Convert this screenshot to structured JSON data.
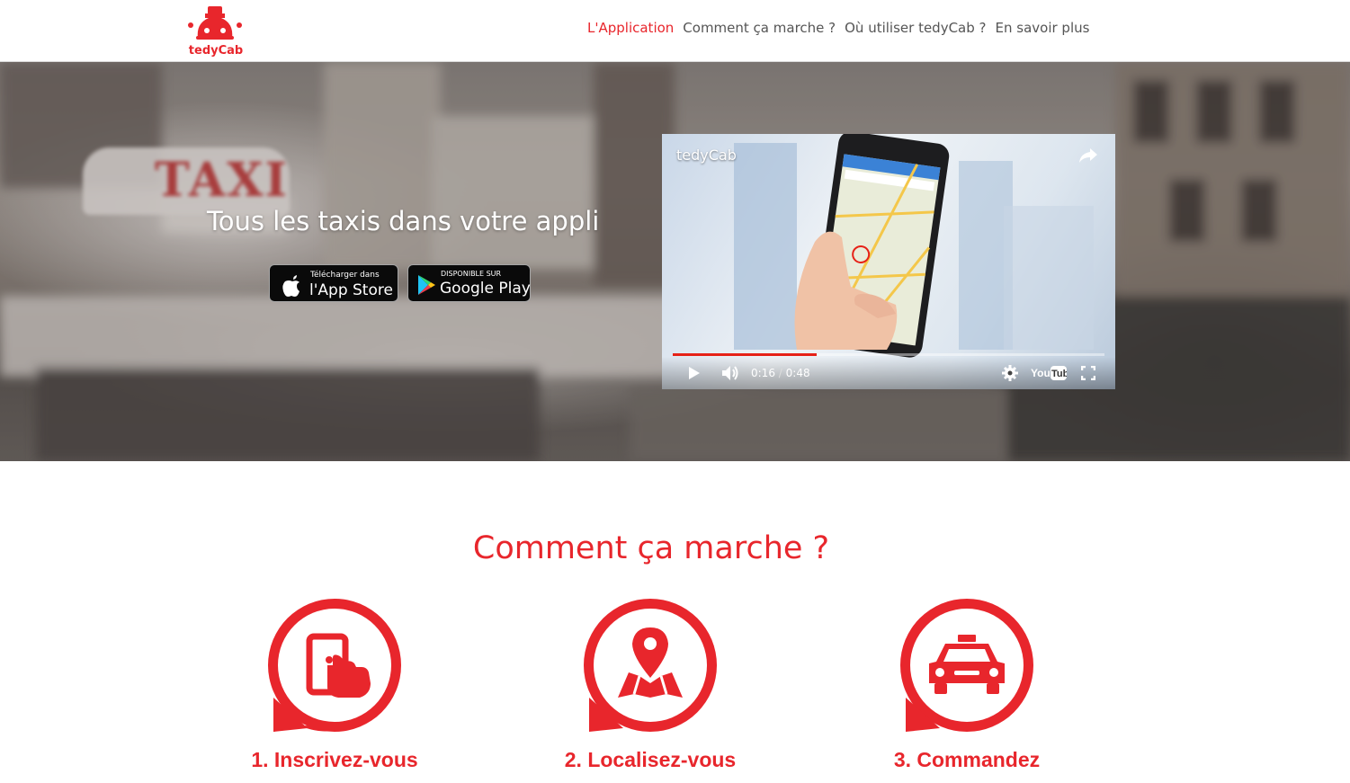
{
  "brand": {
    "name": "tedyCab",
    "accent_color": "#e8262c"
  },
  "nav": {
    "items": [
      {
        "label": "L'Application",
        "active": true
      },
      {
        "label": "Comment ça marche ?",
        "active": false
      },
      {
        "label": "Où utiliser tedyCab ?",
        "active": false
      },
      {
        "label": "En savoir plus",
        "active": false
      }
    ]
  },
  "hero": {
    "title": "Tous les taxis dans votre appli",
    "background_sign": "TAXI",
    "app_store": {
      "sub": "Télécharger dans",
      "main": "l'App Store",
      "icon": "apple-icon"
    },
    "google_play": {
      "sub": "DISPONIBLE SUR",
      "main": "Google Play",
      "icon": "play-triangle-icon"
    }
  },
  "video": {
    "title": "tedyCab",
    "current_time": "0:16",
    "separator": "/",
    "duration": "0:48",
    "progress": 0.333,
    "controls": [
      "play-icon",
      "volume-icon",
      "settings-gear-icon",
      "youtube-logo",
      "fullscreen-icon"
    ],
    "share_icon": "share-arrow-icon"
  },
  "how_it_works": {
    "title": "Comment ça marche ?",
    "steps": [
      {
        "label": "1. Inscrivez-vous",
        "icon": "phone-tap-icon"
      },
      {
        "label": "2. Localisez-vous",
        "icon": "map-pin-icon"
      },
      {
        "label": "3. Commandez",
        "icon": "taxi-car-icon"
      }
    ]
  }
}
